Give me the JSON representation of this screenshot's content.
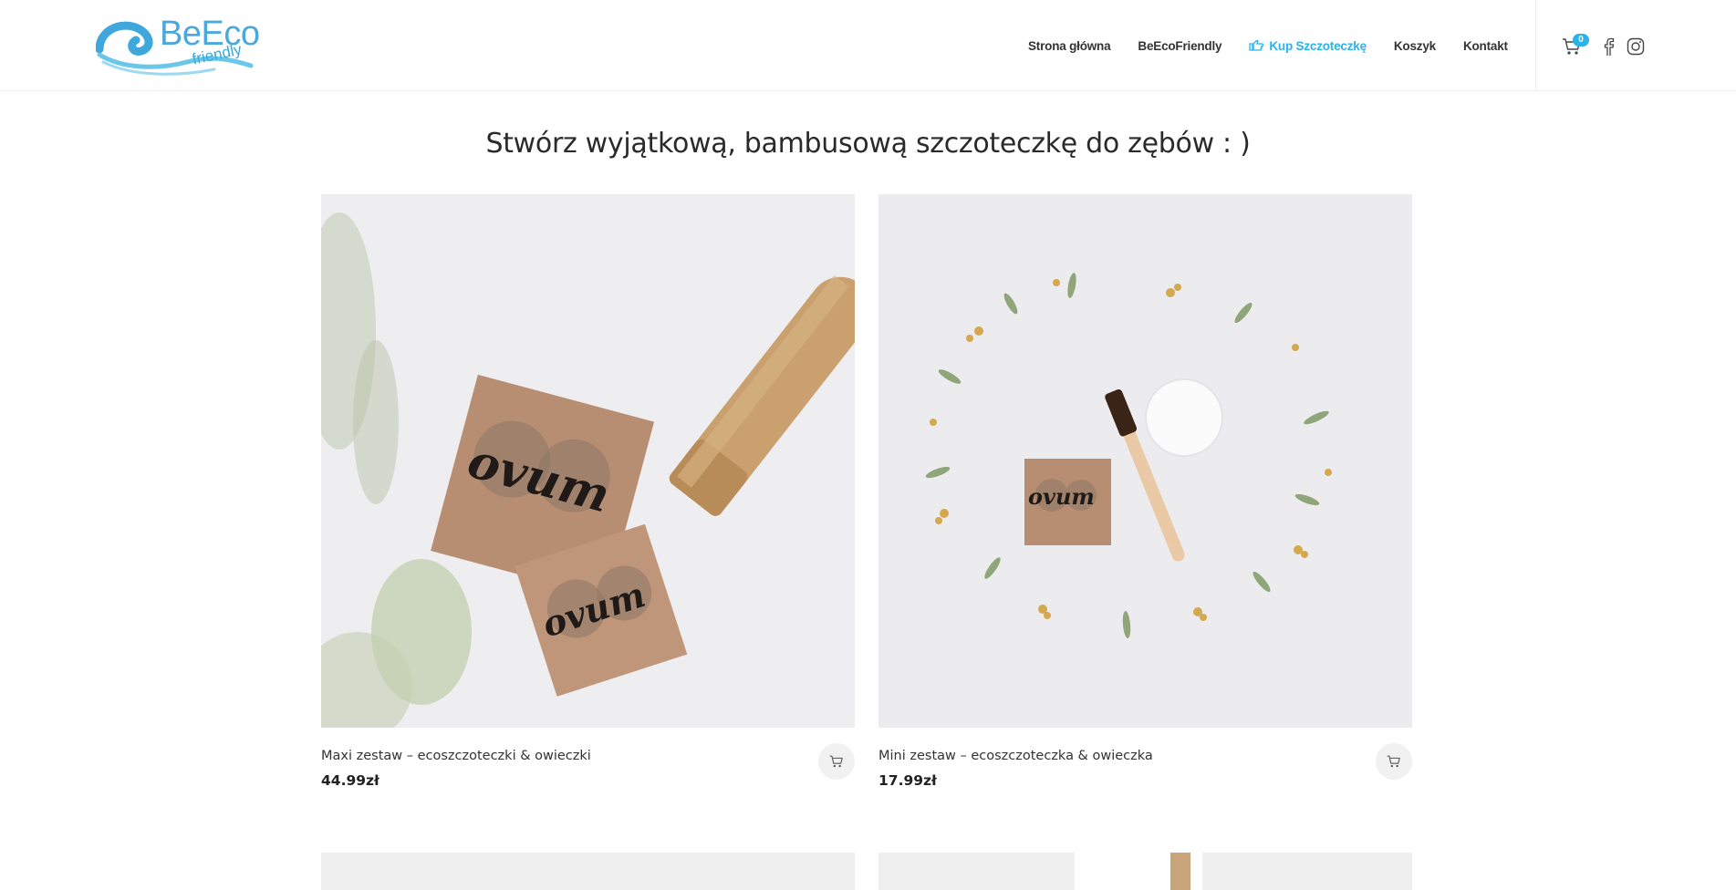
{
  "brand": {
    "logo_main": "BeEco",
    "logo_sub": "friendly",
    "accent": "#29b3e8"
  },
  "nav": {
    "items": [
      {
        "label": "Strona główna",
        "active": false
      },
      {
        "label": "BeEcoFriendly",
        "active": false
      },
      {
        "label": "Kup Szczoteczkę",
        "active": true,
        "icon": "hand-pointer-icon"
      },
      {
        "label": "Koszyk",
        "active": false
      },
      {
        "label": "Kontakt",
        "active": false
      }
    ]
  },
  "header_icons": {
    "cart_count": "0",
    "cart_icon": "shopping-cart-icon",
    "facebook_icon": "facebook-icon",
    "instagram_icon": "instagram-icon"
  },
  "page": {
    "title": "Stwórz wyjątkową, bambusową szczoteczkę do zębów : )"
  },
  "products": [
    {
      "name": "Maxi zestaw – ecoszczoteczki & owieczki",
      "price": "44.99zł",
      "image_label": "ovum",
      "cart_icon": "add-to-cart-icon"
    },
    {
      "name": "Mini zestaw – ecoszczoteczka & owieczka",
      "price": "17.99zł",
      "image_label": "ovum",
      "cart_icon": "add-to-cart-icon"
    }
  ]
}
